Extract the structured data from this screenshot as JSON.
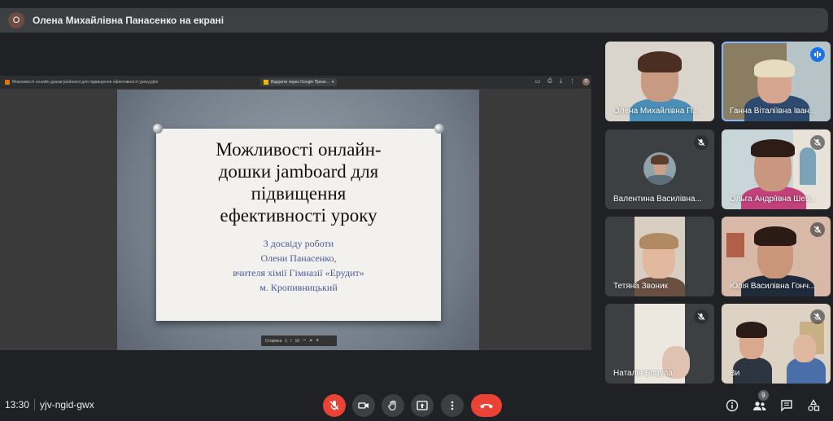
{
  "banner": {
    "avatar_letter": "О",
    "text": "Олена Михайлівна Панасенко на екрані"
  },
  "share": {
    "file_title": "Можливості онлайн дошки jamboard для підвищення ефективності уроку.pptx",
    "open_with": "Відкрити через Google Презе...",
    "user_initial": "О",
    "slide": {
      "title_lines": [
        "Можливості онлайн-",
        "дошки jamboard для",
        "підвищення",
        "ефективності  уроку"
      ],
      "subtitle_lines": [
        "З досвіду роботи",
        "Олени Панасенко,",
        "вчителя хімії Гімназії «Ерудит»",
        "м. Кропивницький"
      ]
    },
    "nav": {
      "page_label": "Сторінка",
      "page": "1",
      "sep": "/",
      "total": "16"
    }
  },
  "participants": [
    {
      "name": "Олена Михайлівна П..."
    },
    {
      "name": "Ганна Віталіївна Іван..."
    },
    {
      "name": "Валентина Василівна..."
    },
    {
      "name": "Ольга Андріївна Шев..."
    },
    {
      "name": "Тетяна Звоник"
    },
    {
      "name": "Юлія Василівна Гонч..."
    },
    {
      "name": "Наталія Боцула"
    },
    {
      "name": "Ви"
    }
  ],
  "footer": {
    "time": "13:30",
    "meeting_code": "yjv-ngid-gwx",
    "people_count": "9"
  },
  "colors": {
    "accent": "#1a73e8",
    "danger": "#ea4335",
    "bg": "#202124"
  }
}
